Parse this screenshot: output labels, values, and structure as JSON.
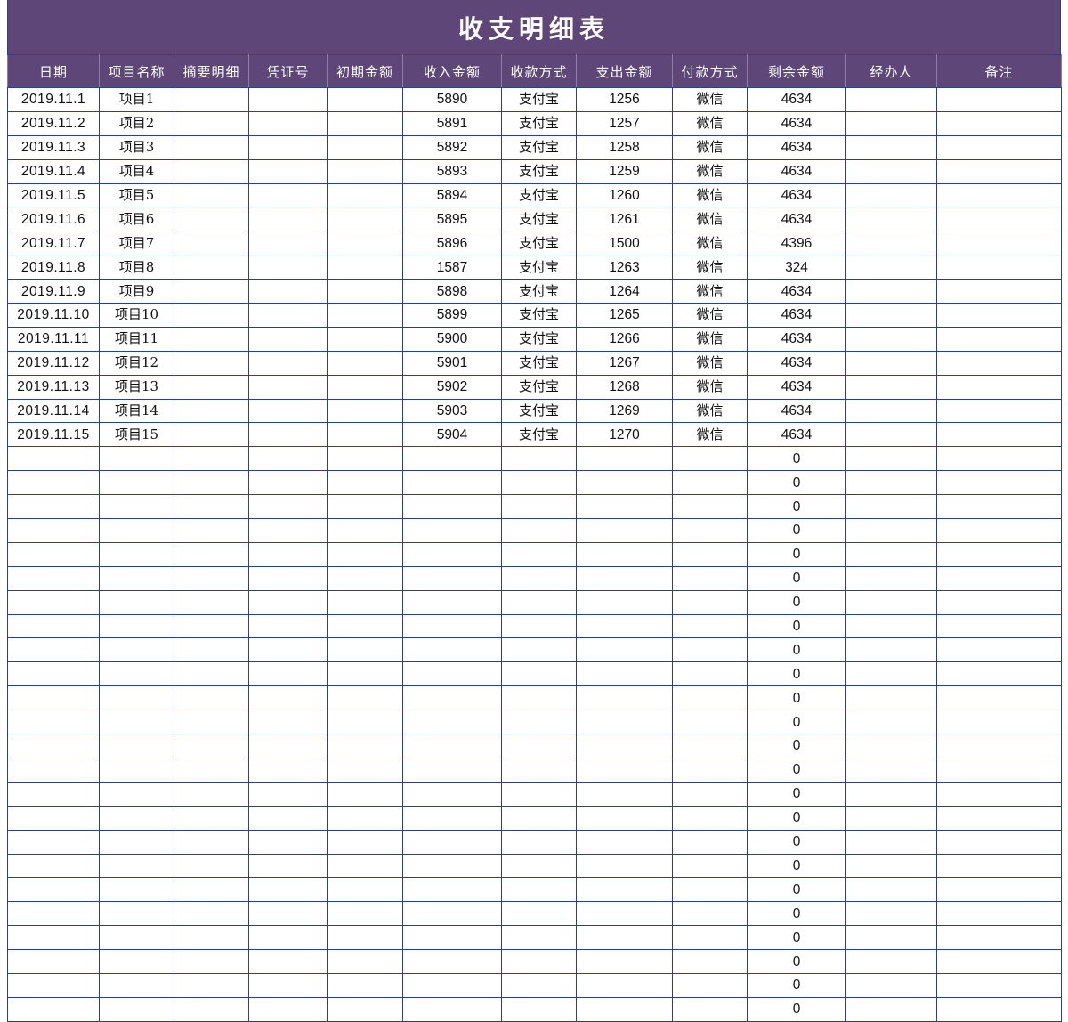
{
  "title": "收支明细表",
  "colors": {
    "header_bg": "#5e4678",
    "header_text": "#ffffff",
    "grid_line": "#2d3f8a"
  },
  "headers": [
    "日期",
    "项目名称",
    "摘要明细",
    "凭证号",
    "初期金额",
    "收入金额",
    "收款方式",
    "支出金额",
    "付款方式",
    "剩余金额",
    "经办人",
    "备注"
  ],
  "rows": [
    [
      "2019.11.1",
      "项目1",
      "",
      "",
      "",
      "5890",
      "支付宝",
      "1256",
      "微信",
      "4634",
      "",
      ""
    ],
    [
      "2019.11.2",
      "项目2",
      "",
      "",
      "",
      "5891",
      "支付宝",
      "1257",
      "微信",
      "4634",
      "",
      ""
    ],
    [
      "2019.11.3",
      "项目3",
      "",
      "",
      "",
      "5892",
      "支付宝",
      "1258",
      "微信",
      "4634",
      "",
      ""
    ],
    [
      "2019.11.4",
      "项目4",
      "",
      "",
      "",
      "5893",
      "支付宝",
      "1259",
      "微信",
      "4634",
      "",
      ""
    ],
    [
      "2019.11.5",
      "项目5",
      "",
      "",
      "",
      "5894",
      "支付宝",
      "1260",
      "微信",
      "4634",
      "",
      ""
    ],
    [
      "2019.11.6",
      "项目6",
      "",
      "",
      "",
      "5895",
      "支付宝",
      "1261",
      "微信",
      "4634",
      "",
      ""
    ],
    [
      "2019.11.7",
      "项目7",
      "",
      "",
      "",
      "5896",
      "支付宝",
      "1500",
      "微信",
      "4396",
      "",
      ""
    ],
    [
      "2019.11.8",
      "项目8",
      "",
      "",
      "",
      "1587",
      "支付宝",
      "1263",
      "微信",
      "324",
      "",
      ""
    ],
    [
      "2019.11.9",
      "项目9",
      "",
      "",
      "",
      "5898",
      "支付宝",
      "1264",
      "微信",
      "4634",
      "",
      ""
    ],
    [
      "2019.11.10",
      "项目10",
      "",
      "",
      "",
      "5899",
      "支付宝",
      "1265",
      "微信",
      "4634",
      "",
      ""
    ],
    [
      "2019.11.11",
      "项目11",
      "",
      "",
      "",
      "5900",
      "支付宝",
      "1266",
      "微信",
      "4634",
      "",
      ""
    ],
    [
      "2019.11.12",
      "项目12",
      "",
      "",
      "",
      "5901",
      "支付宝",
      "1267",
      "微信",
      "4634",
      "",
      ""
    ],
    [
      "2019.11.13",
      "项目13",
      "",
      "",
      "",
      "5902",
      "支付宝",
      "1268",
      "微信",
      "4634",
      "",
      ""
    ],
    [
      "2019.11.14",
      "项目14",
      "",
      "",
      "",
      "5903",
      "支付宝",
      "1269",
      "微信",
      "4634",
      "",
      ""
    ],
    [
      "2019.11.15",
      "项目15",
      "",
      "",
      "",
      "5904",
      "支付宝",
      "1270",
      "微信",
      "4634",
      "",
      ""
    ],
    [
      "",
      "",
      "",
      "",
      "",
      "",
      "",
      "",
      "",
      "0",
      "",
      ""
    ],
    [
      "",
      "",
      "",
      "",
      "",
      "",
      "",
      "",
      "",
      "0",
      "",
      ""
    ],
    [
      "",
      "",
      "",
      "",
      "",
      "",
      "",
      "",
      "",
      "0",
      "",
      ""
    ],
    [
      "",
      "",
      "",
      "",
      "",
      "",
      "",
      "",
      "",
      "0",
      "",
      ""
    ],
    [
      "",
      "",
      "",
      "",
      "",
      "",
      "",
      "",
      "",
      "0",
      "",
      ""
    ],
    [
      "",
      "",
      "",
      "",
      "",
      "",
      "",
      "",
      "",
      "0",
      "",
      ""
    ],
    [
      "",
      "",
      "",
      "",
      "",
      "",
      "",
      "",
      "",
      "0",
      "",
      ""
    ],
    [
      "",
      "",
      "",
      "",
      "",
      "",
      "",
      "",
      "",
      "0",
      "",
      ""
    ],
    [
      "",
      "",
      "",
      "",
      "",
      "",
      "",
      "",
      "",
      "0",
      "",
      ""
    ],
    [
      "",
      "",
      "",
      "",
      "",
      "",
      "",
      "",
      "",
      "0",
      "",
      ""
    ],
    [
      "",
      "",
      "",
      "",
      "",
      "",
      "",
      "",
      "",
      "0",
      "",
      ""
    ],
    [
      "",
      "",
      "",
      "",
      "",
      "",
      "",
      "",
      "",
      "0",
      "",
      ""
    ],
    [
      "",
      "",
      "",
      "",
      "",
      "",
      "",
      "",
      "",
      "0",
      "",
      ""
    ],
    [
      "",
      "",
      "",
      "",
      "",
      "",
      "",
      "",
      "",
      "0",
      "",
      ""
    ],
    [
      "",
      "",
      "",
      "",
      "",
      "",
      "",
      "",
      "",
      "0",
      "",
      ""
    ],
    [
      "",
      "",
      "",
      "",
      "",
      "",
      "",
      "",
      "",
      "0",
      "",
      ""
    ],
    [
      "",
      "",
      "",
      "",
      "",
      "",
      "",
      "",
      "",
      "0",
      "",
      ""
    ],
    [
      "",
      "",
      "",
      "",
      "",
      "",
      "",
      "",
      "",
      "0",
      "",
      ""
    ],
    [
      "",
      "",
      "",
      "",
      "",
      "",
      "",
      "",
      "",
      "0",
      "",
      ""
    ],
    [
      "",
      "",
      "",
      "",
      "",
      "",
      "",
      "",
      "",
      "0",
      "",
      ""
    ],
    [
      "",
      "",
      "",
      "",
      "",
      "",
      "",
      "",
      "",
      "0",
      "",
      ""
    ],
    [
      "",
      "",
      "",
      "",
      "",
      "",
      "",
      "",
      "",
      "0",
      "",
      ""
    ],
    [
      "",
      "",
      "",
      "",
      "",
      "",
      "",
      "",
      "",
      "0",
      "",
      ""
    ],
    [
      "",
      "",
      "",
      "",
      "",
      "",
      "",
      "",
      "",
      "0",
      "",
      ""
    ]
  ]
}
